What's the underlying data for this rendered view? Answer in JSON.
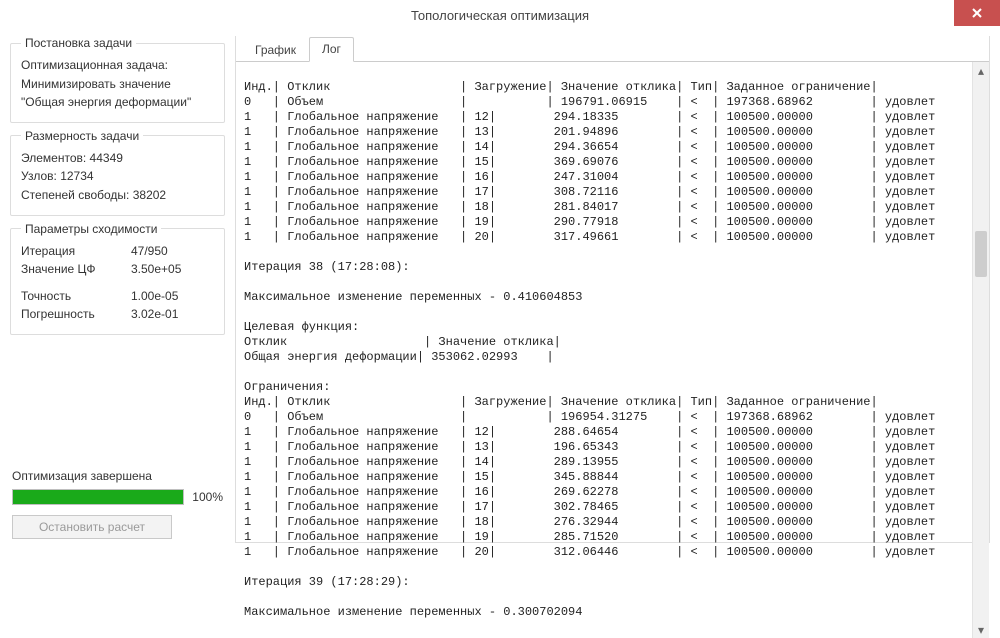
{
  "window": {
    "title": "Топологическая оптимизация"
  },
  "sidebar": {
    "task": {
      "legend": "Постановка задачи",
      "line1": "Оптимизационная задача:",
      "line2": "Минимизировать значение",
      "line3": "\"Общая энергия деформации\""
    },
    "size": {
      "legend": "Размерность задачи",
      "elements_label": "Элементов:",
      "elements": "44349",
      "nodes_label": "Узлов:",
      "nodes": "12734",
      "dof_label": "Степеней свободы:",
      "dof": "38202"
    },
    "conv": {
      "legend": "Параметры сходимости",
      "iter_label": "Итерация",
      "iter": "47/950",
      "of_label": "Значение ЦФ",
      "of": "3.50e+05",
      "tol_label": "Точность",
      "tol": "1.00e-05",
      "err_label": "Погрешность",
      "err": "3.02e-01"
    },
    "status_label": "Оптимизация завершена",
    "progress_pct": "100%",
    "stop_label": "Остановить расчет"
  },
  "tabs": {
    "chart": "График",
    "log": "Лог"
  },
  "log": {
    "header": "Инд.| Отклик                  | Загружение| Значение отклика| Тип| Заданное ограничение|",
    "row_vol37": "0   | Объем                   |           | 196791.06915    | <  | 197368.68962        | удовлет",
    "row37_12": "1   | Глобальное напряжение   | 12|        294.18335        | <  | 100500.00000        | удовлет",
    "row37_13": "1   | Глобальное напряжение   | 13|        201.94896        | <  | 100500.00000        | удовлет",
    "row37_14": "1   | Глобальное напряжение   | 14|        294.36654        | <  | 100500.00000        | удовлет",
    "row37_15": "1   | Глобальное напряжение   | 15|        369.69076        | <  | 100500.00000        | удовлет",
    "row37_16": "1   | Глобальное напряжение   | 16|        247.31004        | <  | 100500.00000        | удовлет",
    "row37_17": "1   | Глобальное напряжение   | 17|        308.72116        | <  | 100500.00000        | удовлет",
    "row37_18": "1   | Глобальное напряжение   | 18|        281.84017        | <  | 100500.00000        | удовлет",
    "row37_19": "1   | Глобальное напряжение   | 19|        290.77918        | <  | 100500.00000        | удовлет",
    "row37_20": "1   | Глобальное напряжение   | 20|        317.49661        | <  | 100500.00000        | удовлет",
    "iter38": "Итерация 38 (17:28:08):",
    "maxchg38": "Максимальное изменение переменных - 0.410604853",
    "tgt_label": "Целевая функция:",
    "tgt_head": "Отклик                   | Значение отклика|",
    "tgt_row": "Общая энергия деформации| 353062.02993    |",
    "constr_label": "Ограничения:",
    "header38": "Инд.| Отклик                  | Загружение| Значение отклика| Тип| Заданное ограничение|",
    "row_vol38": "0   | Объем                   |           | 196954.31275    | <  | 197368.68962        | удовлет",
    "row38_12": "1   | Глобальное напряжение   | 12|        288.64654        | <  | 100500.00000        | удовлет",
    "row38_13": "1   | Глобальное напряжение   | 13|        196.65343        | <  | 100500.00000        | удовлет",
    "row38_14": "1   | Глобальное напряжение   | 14|        289.13955        | <  | 100500.00000        | удовлет",
    "row38_15": "1   | Глобальное напряжение   | 15|        345.88844        | <  | 100500.00000        | удовлет",
    "row38_16": "1   | Глобальное напряжение   | 16|        269.62278        | <  | 100500.00000        | удовлет",
    "row38_17": "1   | Глобальное напряжение   | 17|        302.78465        | <  | 100500.00000        | удовлет",
    "row38_18": "1   | Глобальное напряжение   | 18|        276.32944        | <  | 100500.00000        | удовлет",
    "row38_19": "1   | Глобальное напряжение   | 19|        285.71520        | <  | 100500.00000        | удовлет",
    "row38_20": "1   | Глобальное напряжение   | 20|        312.06446        | <  | 100500.00000        | удовлет",
    "iter39": "Итерация 39 (17:28:29):",
    "maxchg39": "Максимальное изменение переменных - 0.300702094"
  }
}
